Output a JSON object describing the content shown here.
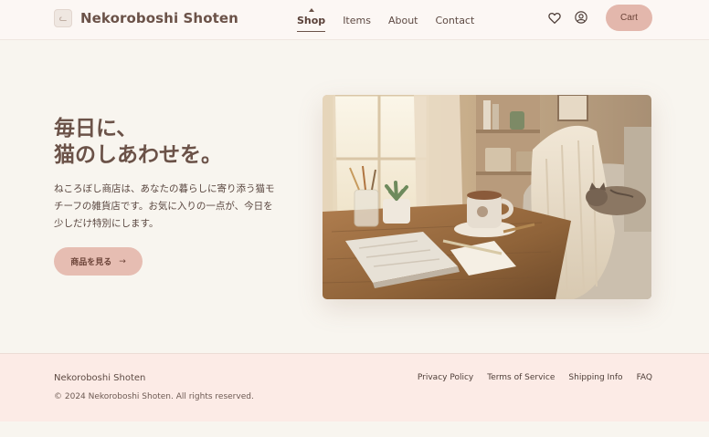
{
  "brand": {
    "name": "Nekoroboshi Shoten",
    "logo_icon": "cat-logo-icon"
  },
  "nav": {
    "items": [
      {
        "label": "Shop",
        "active": true
      },
      {
        "label": "Items",
        "active": false
      },
      {
        "label": "About",
        "active": false
      },
      {
        "label": "Contact",
        "active": false
      }
    ]
  },
  "header_actions": {
    "favorites_icon": "heart-icon",
    "account_icon": "user-icon",
    "cart_label": "Cart"
  },
  "hero": {
    "title_line1": "毎日に、",
    "title_line2": "猫のしあわせを。",
    "description": "ねころぼし商店は、あなたの暮らしに寄り添う猫モチーフの雑貨店です。お気に入りの一点が、今日を少しだけ特別にします。",
    "cta_label": "商品を見る",
    "cta_arrow": "→"
  },
  "footer": {
    "name": "Nekoroboshi Shoten",
    "copyright": "© 2024 Nekoroboshi Shoten. All rights reserved.",
    "links": [
      "Privacy Policy",
      "Terms of Service",
      "Shipping Info",
      "FAQ"
    ]
  },
  "colors": {
    "accent": "#e3b7ac",
    "text": "#6b5248",
    "background": "#f8f5ef",
    "footer_bg": "#fcebe6"
  }
}
